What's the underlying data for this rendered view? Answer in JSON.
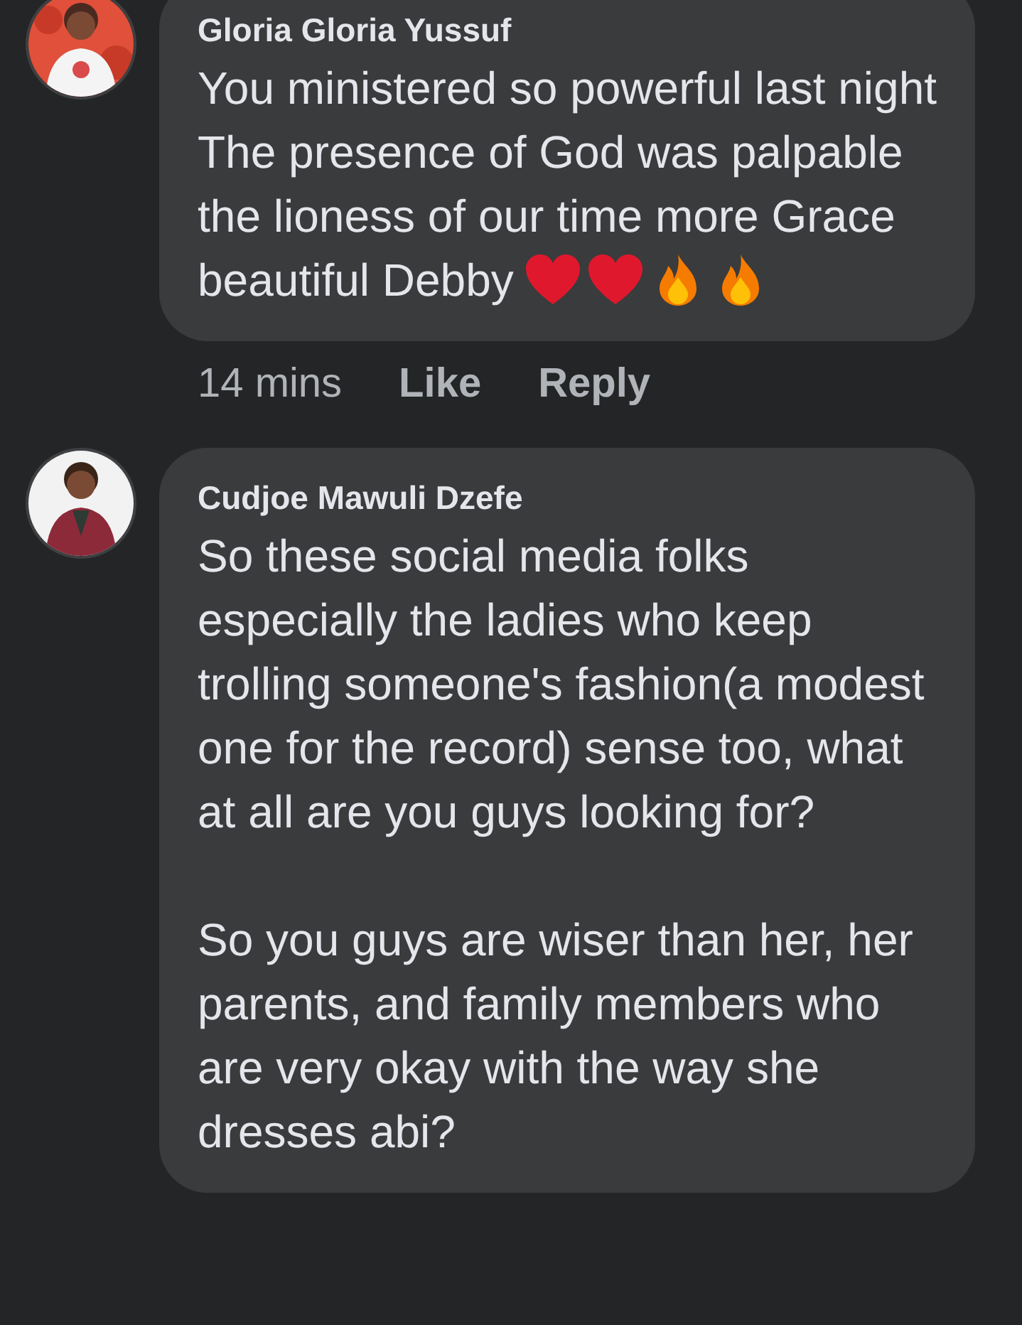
{
  "comments": [
    {
      "author": "Gloria Gloria Yussuf",
      "text": "You ministered so powerful last night\nThe presence of God was palpable the lioness of our time more Grace beautiful Debby",
      "emoji": [
        {
          "kind": "heart"
        },
        {
          "kind": "heart"
        },
        {
          "kind": "fire"
        },
        {
          "kind": "fire"
        }
      ],
      "time": "14 mins",
      "actions": [
        "Like",
        "Reply"
      ]
    },
    {
      "author": "Cudjoe Mawuli Dzefe",
      "text": "So these social media folks especially the ladies who keep trolling someone's fashion(a modest one for the record) sense too, what at all are you guys looking for?\n\nSo you guys are wiser than her, her parents, and family members who are very okay with the way she dresses abi?"
    }
  ]
}
